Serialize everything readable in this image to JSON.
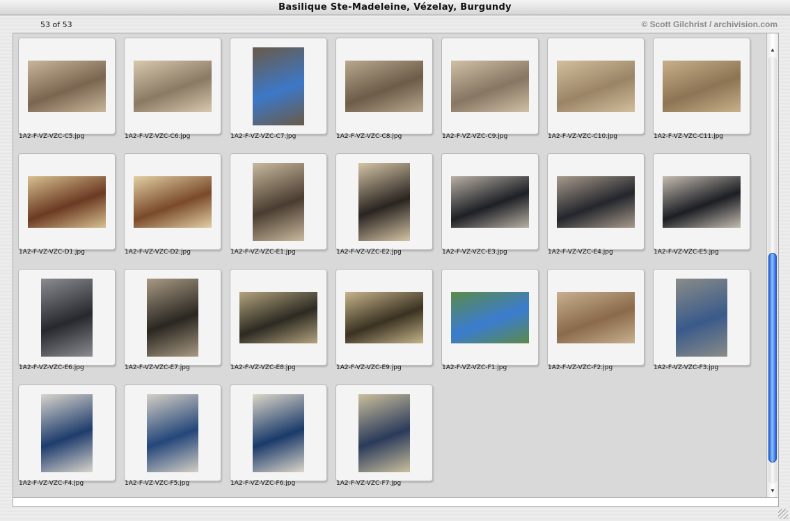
{
  "window": {
    "title": "Basilique Ste-Madeleine, Vézelay, Burgundy",
    "count": "53 of 53",
    "credit": "© Scott Gilchrist / archivision.com"
  },
  "thumbnails": [
    {
      "name": "1A2-F-VZ-VZC-C5.jpg",
      "orientation": "landscape",
      "colors": [
        "#7a6650",
        "#c8b69a"
      ]
    },
    {
      "name": "1A2-F-VZ-VZC-C6.jpg",
      "orientation": "landscape",
      "colors": [
        "#8a7a64",
        "#d7c8ae"
      ]
    },
    {
      "name": "1A2-F-VZ-VZC-C7.jpg",
      "orientation": "portrait",
      "colors": [
        "#3c78c8",
        "#6a5a48"
      ]
    },
    {
      "name": "1A2-F-VZ-VZC-C8.jpg",
      "orientation": "landscape",
      "colors": [
        "#6c5c48",
        "#b8a88e"
      ]
    },
    {
      "name": "1A2-F-VZ-VZC-C9.jpg",
      "orientation": "landscape",
      "colors": [
        "#867662",
        "#cfc0a6"
      ]
    },
    {
      "name": "1A2-F-VZ-VZC-C10.jpg",
      "orientation": "landscape",
      "colors": [
        "#9a8466",
        "#d2bf9c"
      ]
    },
    {
      "name": "1A2-F-VZ-VZC-C11.jpg",
      "orientation": "landscape",
      "colors": [
        "#8c7454",
        "#c8b08a"
      ]
    },
    {
      "name": "1A2-F-VZ-VZC-D1.jpg",
      "orientation": "landscape",
      "colors": [
        "#6b3a22",
        "#d8c090"
      ]
    },
    {
      "name": "1A2-F-VZ-VZC-D2.jpg",
      "orientation": "landscape",
      "colors": [
        "#7a4a2a",
        "#e2cfa4"
      ]
    },
    {
      "name": "1A2-F-VZ-VZC-E1.jpg",
      "orientation": "portrait",
      "colors": [
        "#4a3c30",
        "#c9b99e"
      ]
    },
    {
      "name": "1A2-F-VZ-VZC-E2.jpg",
      "orientation": "portrait",
      "colors": [
        "#2a2420",
        "#d4c4a6"
      ]
    },
    {
      "name": "1A2-F-VZ-VZC-E3.jpg",
      "orientation": "landscape",
      "colors": [
        "#1e2026",
        "#b8b0a4"
      ]
    },
    {
      "name": "1A2-F-VZ-VZC-E4.jpg",
      "orientation": "landscape",
      "colors": [
        "#24262c",
        "#a89a8c"
      ]
    },
    {
      "name": "1A2-F-VZ-VZC-E5.jpg",
      "orientation": "landscape",
      "colors": [
        "#1c1e24",
        "#c4bcb0"
      ]
    },
    {
      "name": "1A2-F-VZ-VZC-E6.jpg",
      "orientation": "portrait",
      "colors": [
        "#26282e",
        "#8a8c90"
      ]
    },
    {
      "name": "1A2-F-VZ-VZC-E7.jpg",
      "orientation": "portrait",
      "colors": [
        "#2a2620",
        "#a89a84"
      ]
    },
    {
      "name": "1A2-F-VZ-VZC-E8.jpg",
      "orientation": "landscape",
      "colors": [
        "#2c2a22",
        "#b4a47e"
      ]
    },
    {
      "name": "1A2-F-VZ-VZC-E9.jpg",
      "orientation": "landscape",
      "colors": [
        "#3a3222",
        "#c6b48a"
      ]
    },
    {
      "name": "1A2-F-VZ-VZC-F1.jpg",
      "orientation": "landscape",
      "colors": [
        "#3a7cd0",
        "#5c8a4a"
      ]
    },
    {
      "name": "1A2-F-VZ-VZC-F2.jpg",
      "orientation": "landscape",
      "colors": [
        "#8a6a4a",
        "#c8b090"
      ]
    },
    {
      "name": "1A2-F-VZ-VZC-F3.jpg",
      "orientation": "portrait",
      "colors": [
        "#3a5a8a",
        "#8a8c88"
      ]
    },
    {
      "name": "1A2-F-VZ-VZC-F4.jpg",
      "orientation": "portrait",
      "colors": [
        "#1e3c6c",
        "#d8d4cc"
      ]
    },
    {
      "name": "1A2-F-VZ-VZC-F5.jpg",
      "orientation": "portrait",
      "colors": [
        "#24467a",
        "#d4cfc4"
      ]
    },
    {
      "name": "1A2-F-VZ-VZC-F6.jpg",
      "orientation": "portrait",
      "colors": [
        "#1a3a6a",
        "#dcd6c8"
      ]
    },
    {
      "name": "1A2-F-VZ-VZC-F7.jpg",
      "orientation": "portrait",
      "colors": [
        "#2a3a5a",
        "#cabf9c"
      ]
    }
  ],
  "scroll": {
    "position": 0.9,
    "visible_fraction": 0.49
  }
}
